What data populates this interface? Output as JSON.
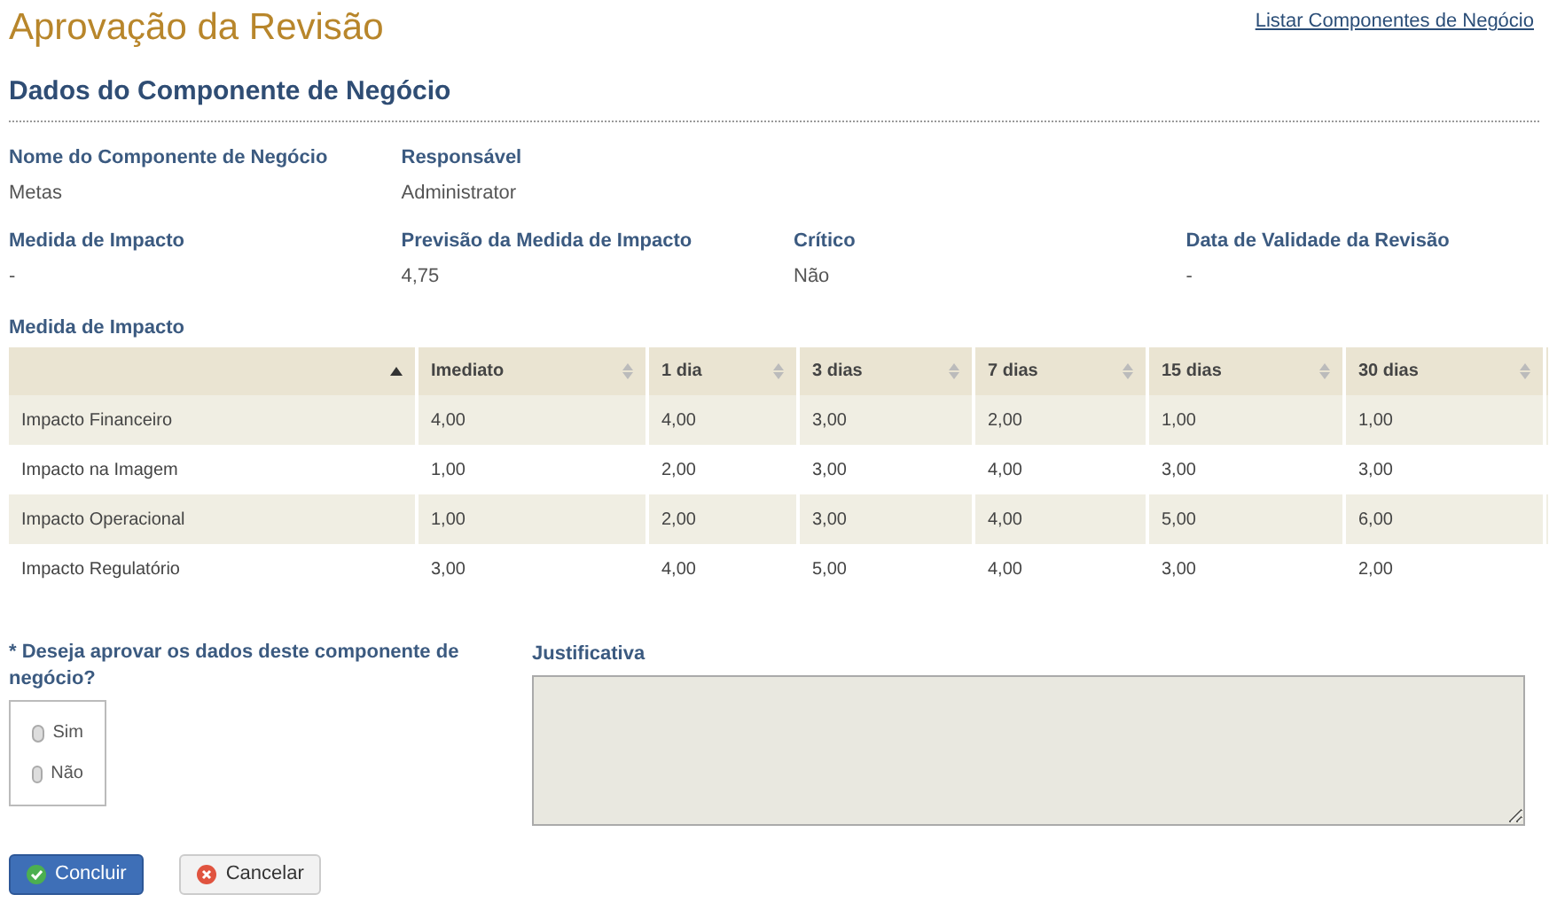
{
  "page_title": "Aprovação da Revisão",
  "top_link": "Listar Componentes de Negócio",
  "section_title": "Dados do Componente de Negócio",
  "fields": [
    {
      "label": "Nome do Componente de Negócio",
      "value": "Metas"
    },
    {
      "label": "Responsável",
      "value": "Administrator"
    },
    {
      "label": "Medida de Impacto",
      "value": "-"
    },
    {
      "label": "Previsão da Medida de Impacto",
      "value": "4,75"
    },
    {
      "label": "Crítico",
      "value": "Não"
    },
    {
      "label": "Data de Validade da Revisão",
      "value": "-"
    }
  ],
  "table": {
    "title": "Medida de Impacto",
    "columns": [
      {
        "sorted": true
      },
      {
        "label": "Imediato",
        "sorted": false
      },
      {
        "label": "1 dia",
        "sorted": false
      },
      {
        "label": "3 dias",
        "sorted": false
      },
      {
        "label": "7 dias",
        "sorted": false
      },
      {
        "label": "15 dias",
        "sorted": false
      },
      {
        "label": "30 dias",
        "sorted": false
      }
    ],
    "rows": [
      [
        "Impacto Financeiro",
        "4,00",
        "4,00",
        "3,00",
        "2,00",
        "1,00",
        "1,00"
      ],
      [
        "Impacto na Imagem",
        "1,00",
        "2,00",
        "3,00",
        "4,00",
        "3,00",
        "3,00"
      ],
      [
        "Impacto Operacional",
        "1,00",
        "2,00",
        "3,00",
        "4,00",
        "5,00",
        "6,00"
      ],
      [
        "Impacto Regulatório",
        "3,00",
        "4,00",
        "5,00",
        "4,00",
        "3,00",
        "2,00"
      ]
    ]
  },
  "question": {
    "label": "* Deseja aprovar os dados deste componente de negócio?",
    "options": [
      {
        "label": "Sim",
        "selected": false
      },
      {
        "label": "Não",
        "selected": false
      }
    ]
  },
  "justification": {
    "label": "Justificativa"
  },
  "buttons": [
    {
      "kind": "primary",
      "label": "Concluir"
    },
    {
      "kind": "secondary",
      "label": "Cancelar"
    }
  ]
}
